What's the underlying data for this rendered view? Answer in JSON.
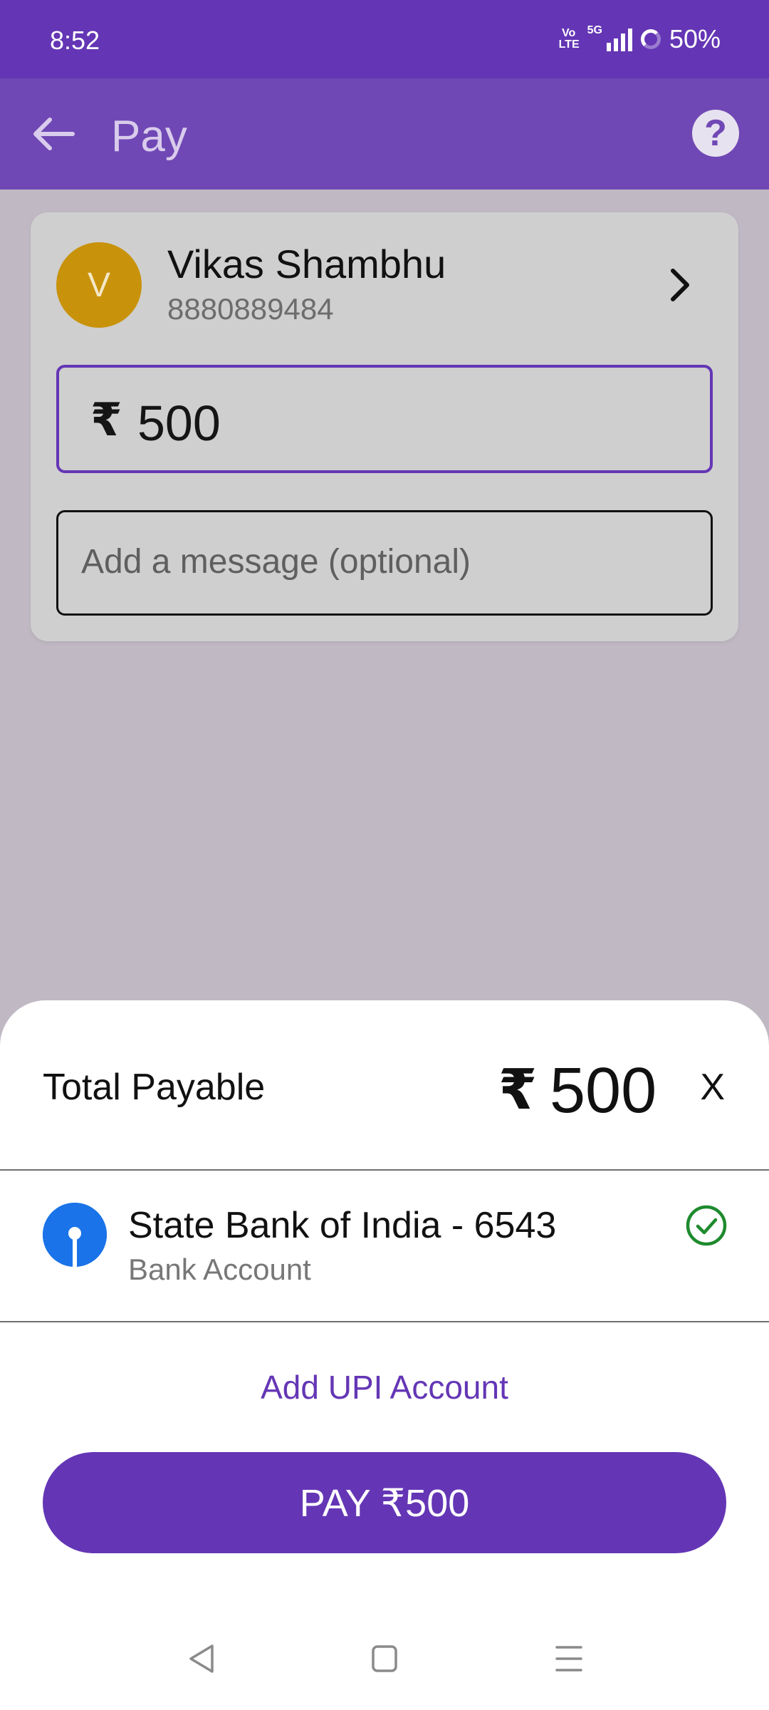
{
  "status_bar": {
    "time": "8:52",
    "volte_label": "Vo LTE",
    "network": "5G",
    "battery": "50%"
  },
  "header": {
    "title": "Pay",
    "back_icon": "arrow-left-icon",
    "help_icon": "question-mark-icon"
  },
  "payee": {
    "avatar_letter": "V",
    "name": "Vikas Shambhu",
    "phone": "8880889484"
  },
  "amount_field": {
    "currency": "₹",
    "value": "500"
  },
  "message_field": {
    "placeholder": "Add a message (optional)",
    "value": ""
  },
  "sheet": {
    "total_label": "Total Payable",
    "currency": "₹",
    "total_amount": "500",
    "close_label": "X",
    "bank_name": "State Bank of India - 6543",
    "bank_type": "Bank Account",
    "add_account_label": "Add UPI Account",
    "pay_button_label": "PAY  ₹500"
  },
  "colors": {
    "brand": "#6436b5",
    "app_bar": "#7048b5",
    "avatar": "#c8920b",
    "bank_logo": "#1a73e8",
    "check": "#1e8a2e"
  }
}
